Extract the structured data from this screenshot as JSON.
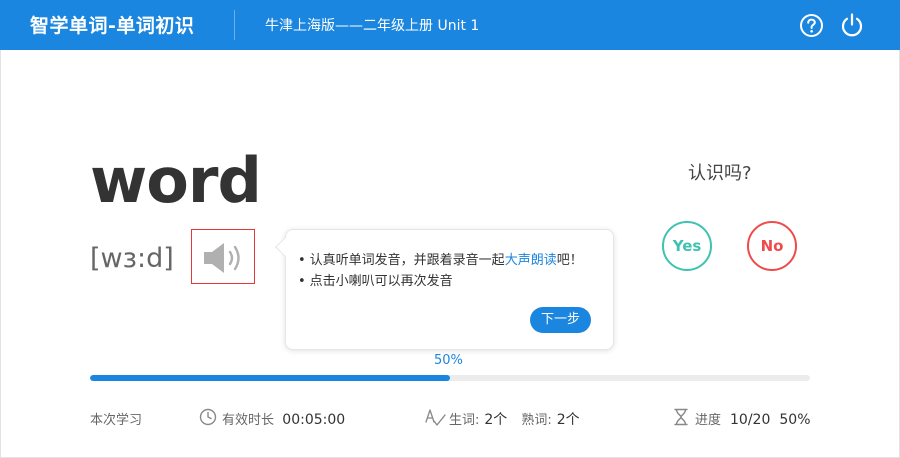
{
  "header": {
    "app_title": "智学单词-单词初识",
    "book_title": "牛津上海版——二年级上册 Unit 1",
    "help_icon": "help-circle-icon",
    "power_icon": "power-icon"
  },
  "card": {
    "word": "word",
    "phonetic": "[wɜ:d]",
    "speaker_icon": "speaker-icon"
  },
  "tooltip": {
    "line1_before": "认真听单词发音，并跟着录音一起",
    "line1_highlight": "大声朗读",
    "line1_after": "吧！",
    "line2": "点击小喇叭可以再次发音",
    "next_label": "下一步"
  },
  "question": {
    "prompt": "认识吗?",
    "yes_label": "Yes",
    "no_label": "No"
  },
  "progress": {
    "percent_label": "50%",
    "fraction": 0.5
  },
  "footer": {
    "session_label": "本次学习",
    "duration_label": "有效时长",
    "duration_value": "00:05:00",
    "new_words_label": "生词:",
    "new_words_value": "2个",
    "known_words_label": "熟词:",
    "known_words_value": "2个",
    "progress_label": "进度",
    "progress_value": "10/20",
    "progress_percent": "50%"
  },
  "colors": {
    "primary": "#1b86e0",
    "yes": "#3ec2b1",
    "no": "#ef4b4b"
  }
}
